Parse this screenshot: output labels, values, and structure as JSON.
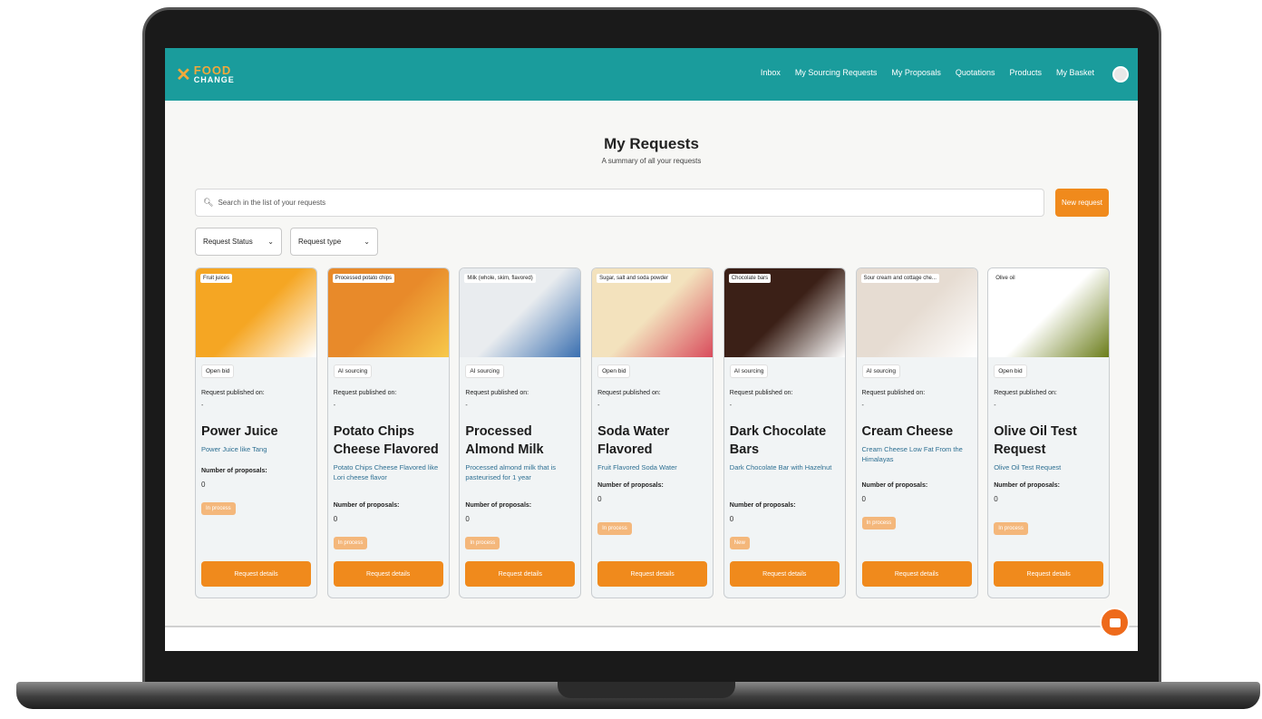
{
  "brand": {
    "food": "FOOD",
    "change": "CHANGE"
  },
  "nav": {
    "links": [
      "Inbox",
      "My Sourcing Requests",
      "My Proposals",
      "Quotations",
      "Products",
      "My Basket"
    ]
  },
  "header": {
    "title": "My Requests",
    "subtitle": "A summary of all your requests"
  },
  "search": {
    "placeholder": "Search in the list of your requests"
  },
  "new_request_label": "New request",
  "filters": {
    "status": "Request Status",
    "type": "Request type"
  },
  "labels": {
    "published": "Request published on:",
    "proposals": "Number of proposals:",
    "details": "Request details"
  },
  "colors": {
    "teal": "#1a9c9c",
    "orange": "#f08a1c",
    "badge": "#f4b77b",
    "link": "#2d6f92"
  },
  "cards": [
    {
      "category": "Fruit juices",
      "tag": "Open bid",
      "date": "-",
      "title": "Power Juice",
      "description": "Power Juice like Tang",
      "proposals": "0",
      "status": "In process",
      "image_colors": [
        "#f5a623",
        "#ffffff"
      ]
    },
    {
      "category": "Processed potato chips",
      "tag": "AI sourcing",
      "date": "-",
      "title": "Potato Chips Cheese Flavored",
      "description": "Potato Chips Cheese Flavored like Lori cheese flavor",
      "proposals": "0",
      "status": "In process",
      "image_colors": [
        "#e88a2a",
        "#f7c94b"
      ]
    },
    {
      "category": "Milk (whole, skim, flavored)",
      "tag": "AI sourcing",
      "date": "-",
      "title": "Processed Almond Milk",
      "description": "Processed almond milk that is pasteurised for 1 year",
      "proposals": "0",
      "status": "In process",
      "image_colors": [
        "#e9ecef",
        "#3a6fb0"
      ]
    },
    {
      "category": "Sugar, salt and soda powder",
      "tag": "Open bid",
      "date": "-",
      "title": "Soda Water Flavored",
      "description": "Fruit Flavored Soda Water",
      "proposals": "0",
      "status": "In process",
      "image_colors": [
        "#f3e2bd",
        "#d94c5c"
      ]
    },
    {
      "category": "Chocolate bars",
      "tag": "AI sourcing",
      "date": "-",
      "title": "Dark Chocolate Bars",
      "description": "Dark Chocolate Bar with Hazelnut",
      "proposals": "0",
      "status": "New",
      "image_colors": [
        "#3b2017",
        "#ffffff"
      ]
    },
    {
      "category": "Sour cream and cottage che...",
      "tag": "AI sourcing",
      "date": "-",
      "title": "Cream Cheese",
      "description": "Cream Cheese Low Fat From the Himalayas",
      "proposals": "0",
      "status": "In process",
      "image_colors": [
        "#e6dcd2",
        "#ffffff"
      ]
    },
    {
      "category": "Olive oil",
      "tag": "Open bid",
      "date": "-",
      "title": "Olive Oil Test Request",
      "description": "Olive Oil Test Request",
      "proposals": "0",
      "status": "In process",
      "image_colors": [
        "#ffffff",
        "#6b7d1a"
      ]
    }
  ]
}
